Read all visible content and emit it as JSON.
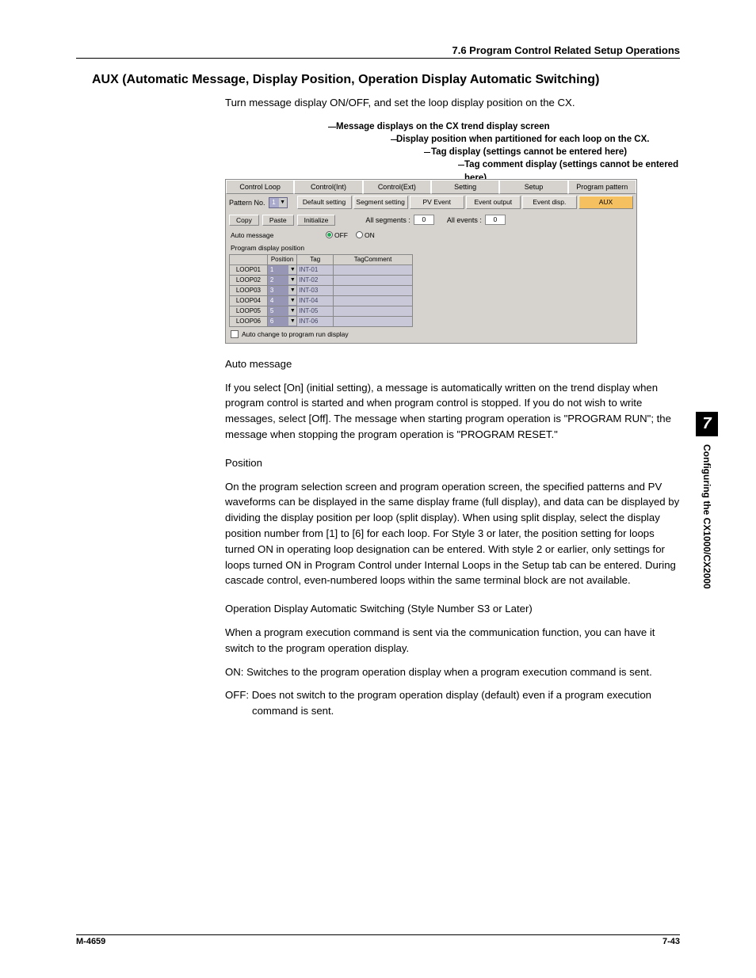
{
  "header": "7.6  Program Control Related Setup Operations",
  "title": "AUX (Automatic Message, Display Position, Operation Display Automatic Switching)",
  "intro": "Turn message display ON/OFF, and set the loop display position on the CX.",
  "callout1": "Message displays on the CX trend display screen",
  "callout2": "Display position when partitioned for each loop on the CX.",
  "callout3": "Tag display (settings cannot be entered here)",
  "callout4": "Tag comment display (settings cannot be entered here)",
  "app": {
    "tabs": [
      "Control Loop",
      "Control(Int)",
      "Control(Ext)",
      "Setting",
      "Setup",
      "Program pattern"
    ],
    "subtabs": [
      "Default setting",
      "Segment setting",
      "PV Event",
      "Event output",
      "Event disp.",
      "AUX"
    ],
    "patternNoLabel": "Pattern No.",
    "patternNoValue": "1",
    "copy": "Copy",
    "paste": "Paste",
    "initialize": "Initialize",
    "allSegmentsLabel": "All segments :",
    "allSegmentsValue": "0",
    "allEventsLabel": "All events :",
    "allEventsValue": "0",
    "autoMessageLabel": "Auto message",
    "off": "OFF",
    "on": "ON",
    "posLabel": "Program display position",
    "thPos": "Position",
    "thTag": "Tag",
    "thTagC": "TagComment",
    "rows": [
      {
        "loop": "LOOP01",
        "pos": "1",
        "tag": "INT-01"
      },
      {
        "loop": "LOOP02",
        "pos": "2",
        "tag": "INT-02"
      },
      {
        "loop": "LOOP03",
        "pos": "3",
        "tag": "INT-03"
      },
      {
        "loop": "LOOP04",
        "pos": "4",
        "tag": "INT-04"
      },
      {
        "loop": "LOOP05",
        "pos": "5",
        "tag": "INT-05"
      },
      {
        "loop": "LOOP06",
        "pos": "6",
        "tag": "INT-06"
      }
    ],
    "checkbox": "Auto change to program run display"
  },
  "s1h": "Auto message",
  "s1": "If you select [On] (initial setting), a message is automatically written on the trend display when program control is started and when program control is stopped.  If you do not wish to write messages, select [Off].  The message when starting program operation is \"PROGRAM RUN\"; the message when stopping the program operation is \"PROGRAM RESET.\"",
  "s2h": "Position",
  "s2": "On the program selection screen and program operation screen, the specified patterns and PV waveforms can be displayed in the same display frame (full display), and data can be displayed by dividing the display position per loop (split display). When using split display, select the display position number from [1] to [6] for each loop. For Style 3 or later, the position setting for loops turned ON in operating loop designation can be entered. With style 2 or earlier, only settings for loops turned ON in Program Control under Internal Loops in the Setup tab can be entered. During cascade control, even-numbered loops within the same terminal block are not available.",
  "s3h": "Operation Display Automatic Switching (Style Number S3 or Later)",
  "s3a": "When a program execution command is sent via the communication function, you can have it switch to the program operation display.",
  "s3on": "ON:  Switches to the program operation display when a program execution command is sent.",
  "s3off": "OFF: Does not switch to the program operation display (default) even if a program execution command is sent.",
  "footer_left": "M-4659",
  "footer_right": "7-43",
  "side_num": "7",
  "side_label": "Configuring the CX1000/CX2000"
}
